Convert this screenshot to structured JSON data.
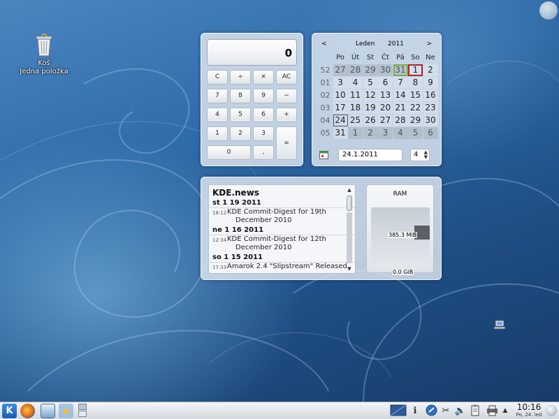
{
  "desktop": {
    "trash": {
      "name": "Koš",
      "count": "Jedna položka"
    }
  },
  "calculator": {
    "display": "0",
    "buttons": [
      [
        "C",
        "÷",
        "×",
        "AC"
      ],
      [
        "7",
        "8",
        "9",
        "−"
      ],
      [
        "4",
        "5",
        "6",
        "+"
      ],
      [
        "1",
        "2",
        "3",
        "="
      ],
      [
        "0",
        ","
      ]
    ]
  },
  "calendar": {
    "prev": "<",
    "next": ">",
    "month": "Leden",
    "year": "2011",
    "weekdays": [
      "Po",
      "Út",
      "St",
      "Čt",
      "Pá",
      "So",
      "Ne"
    ],
    "weeks": [
      {
        "num": "52",
        "days": [
          "27",
          "28",
          "29",
          "30",
          "31",
          "1",
          "2"
        ]
      },
      {
        "num": "01",
        "days": [
          "3",
          "4",
          "5",
          "6",
          "7",
          "8",
          "9"
        ]
      },
      {
        "num": "02",
        "days": [
          "10",
          "11",
          "12",
          "13",
          "14",
          "15",
          "16"
        ]
      },
      {
        "num": "03",
        "days": [
          "17",
          "18",
          "19",
          "20",
          "21",
          "22",
          "23"
        ]
      },
      {
        "num": "04",
        "days": [
          "24",
          "25",
          "26",
          "27",
          "28",
          "29",
          "30"
        ]
      },
      {
        "num": "05",
        "days": [
          "31",
          "1",
          "2",
          "3",
          "4",
          "5",
          "6"
        ]
      }
    ],
    "date_field": "24.1.2011",
    "week_field": "4"
  },
  "news": {
    "title": "KDE.news",
    "groups": [
      {
        "day": "st 1 19 2011",
        "items": [
          {
            "time": "18:12",
            "line1": "KDE Commit-Digest for 19th",
            "line2": "December 2010"
          }
        ]
      },
      {
        "day": "ne 1 16 2011",
        "items": [
          {
            "time": "12:34",
            "line1": "KDE Commit-Digest for 12th",
            "line2": "December 2010"
          }
        ]
      },
      {
        "day": "so 1 15 2011",
        "items": [
          {
            "time": "17:33",
            "line1": "Amarok 2.4 \"Slipstream\" Released",
            "line2": ""
          }
        ]
      }
    ],
    "scroll_up": "▲",
    "scroll_down": "▼"
  },
  "ram": {
    "title": "RAM",
    "max_label": "385.3 MiB",
    "min_label": "0.0 GiB",
    "fill_color": "#5b6067"
  },
  "taskbar": {
    "kde_label": "K",
    "star_label": "★",
    "tray": {
      "info": "ℹ",
      "scissors": "✂",
      "volume": "🔈",
      "up_arrow": "▲"
    },
    "clock_time": "10:16",
    "clock_date": "Po, 24. led"
  },
  "icons": [
    "trash-icon",
    "kde-icon",
    "firefox-icon",
    "document-icon",
    "star-icon",
    "network-icon",
    "calendar-icon"
  ]
}
